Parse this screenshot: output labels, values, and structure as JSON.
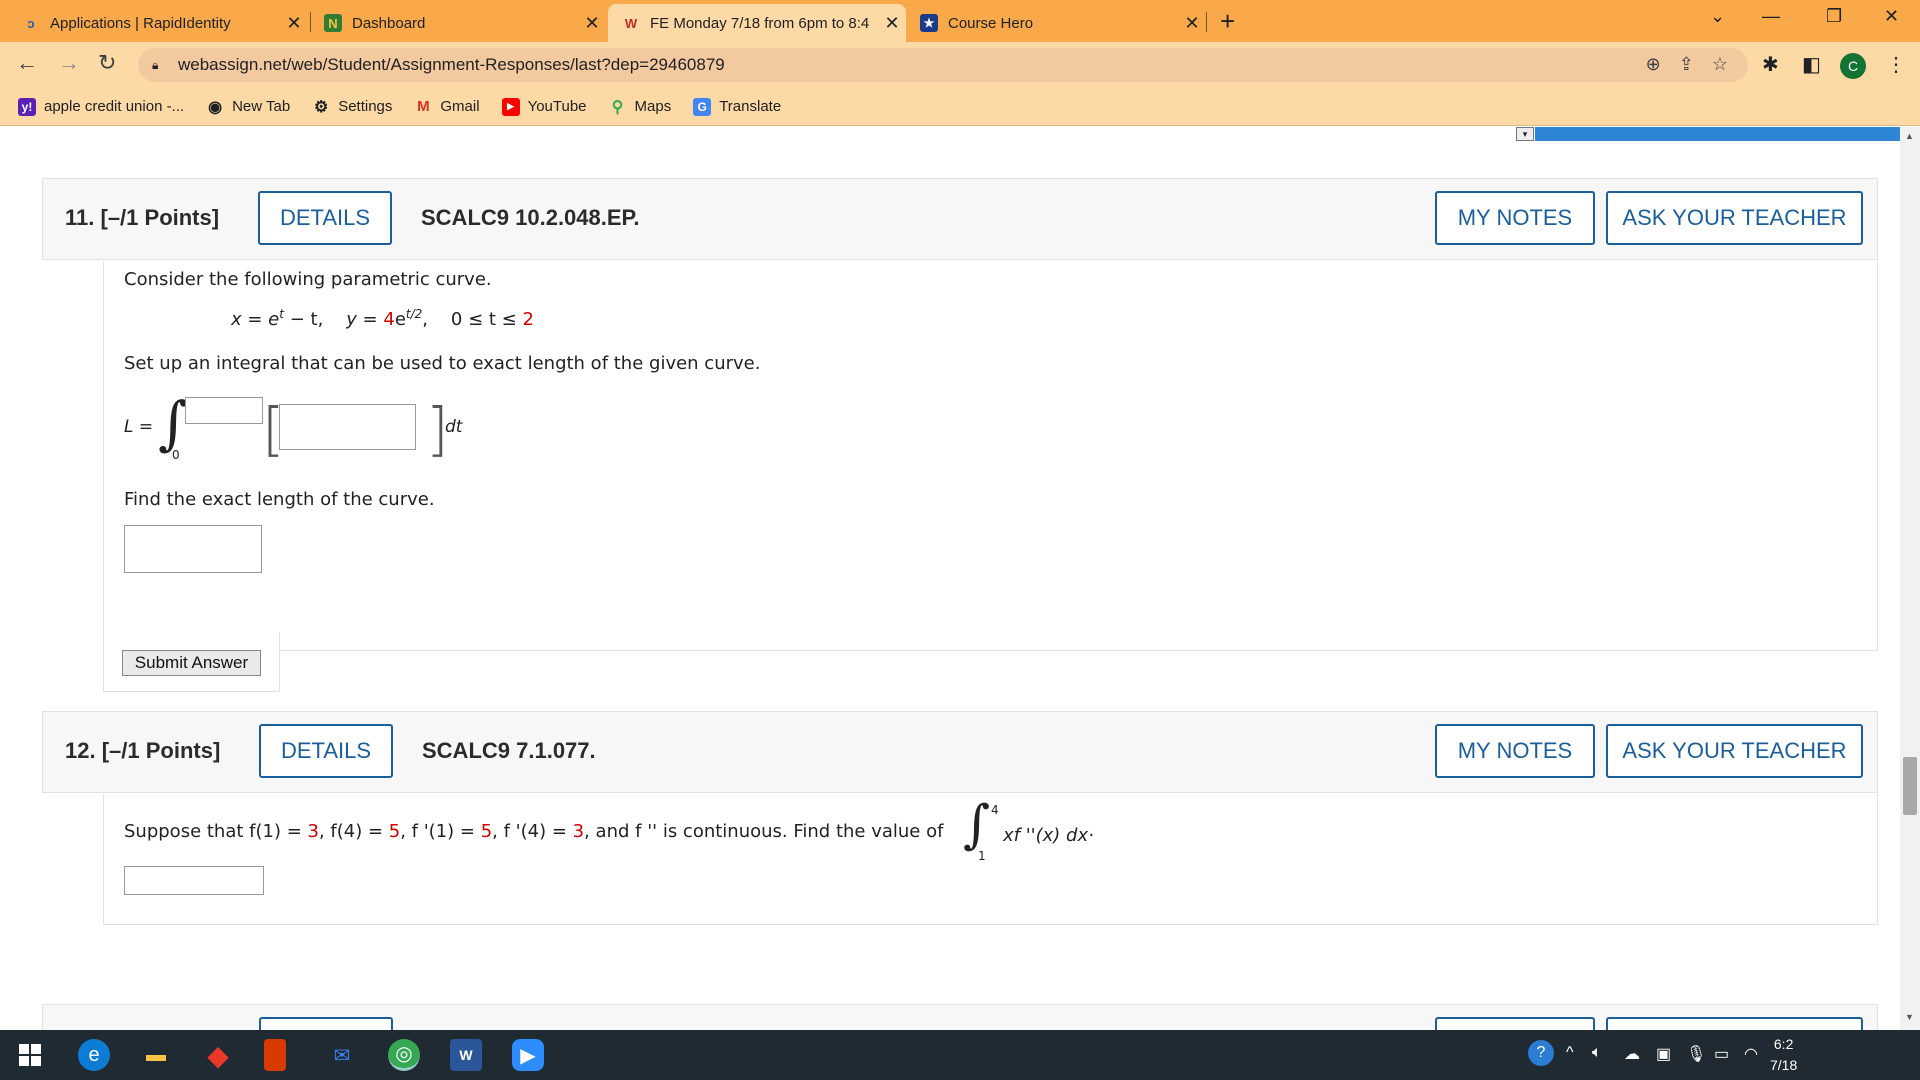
{
  "tabs": [
    {
      "title": "Applications | RapidIdentity",
      "favicon": "R"
    },
    {
      "title": "Dashboard",
      "favicon": "N"
    },
    {
      "title": "FE Monday 7/18 from 6pm to 8:4",
      "favicon": "W"
    },
    {
      "title": "Course Hero",
      "favicon": "★"
    }
  ],
  "address": {
    "url": "webassign.net/web/Student/Assignment-Responses/last?dep=29460879"
  },
  "profile_initial": "C",
  "bookmarks": [
    {
      "label": "apple credit union -...",
      "icon": "y!"
    },
    {
      "label": "New Tab",
      "icon": "◉"
    },
    {
      "label": "Settings",
      "icon": "⚙"
    },
    {
      "label": "Gmail",
      "icon": "M"
    },
    {
      "label": "YouTube",
      "icon": "▶"
    },
    {
      "label": "Maps",
      "icon": "⚲"
    },
    {
      "label": "Translate",
      "icon": "G"
    }
  ],
  "q11": {
    "number": "11.",
    "points": "[–/1 Points]",
    "details": "DETAILS",
    "code": "SCALC9 10.2.048.EP.",
    "my_notes": "MY NOTES",
    "ask_teacher": "ASK YOUR TEACHER",
    "intro": "Consider the following parametric curve.",
    "eq_x": "x = e",
    "eq_x_sup": "t",
    "eq_x_tail": " − t,",
    "eq_y": "y = ",
    "eq_y_coef": "4",
    "eq_y_base": "e",
    "eq_y_sup": "t/2",
    "eq_y_tail": ",",
    "eq_range": "0 ≤ t ≤ ",
    "eq_range_end": "2",
    "setup": "Set up an integral that can be used to exact length of the given curve.",
    "L_label": "L =",
    "lower_limit": "0",
    "dt": "dt",
    "find": "Find the exact length of the curve.",
    "submit": "Submit Answer"
  },
  "q12": {
    "number": "12.",
    "points": "[–/1 Points]",
    "details": "DETAILS",
    "code": "SCALC9 7.1.077.",
    "my_notes": "MY NOTES",
    "ask_teacher": "ASK YOUR TEACHER",
    "s1": "Suppose that f(1) = ",
    "v1": "3",
    "s2": ", f(4) = ",
    "v2": "5",
    "s3": ", f '(1) = ",
    "v3": "5",
    "s4": ", f '(4) = ",
    "v4": "3",
    "s5": ", and f '' is continuous. Find the value of",
    "upper": "4",
    "lower": "1",
    "integrand": "xf ''(x) dx·"
  },
  "clock": {
    "time": "6:2",
    "date": "7/18"
  }
}
